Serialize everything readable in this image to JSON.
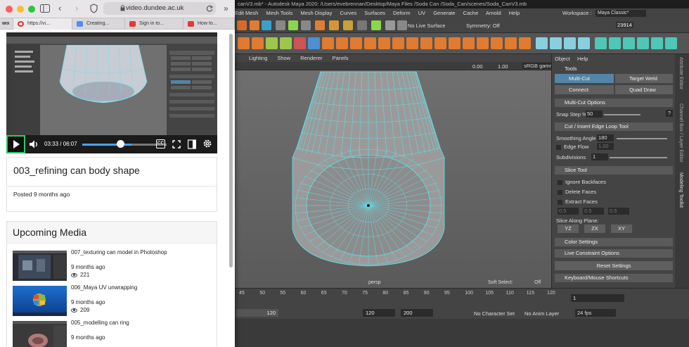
{
  "maya": {
    "title": "canV3.mb* - Autodesk Maya 2020: /Users/evebrennan/Desktop/Maya Files /Soda Can /Soda_Can/scenes/Soda_CanV3.mb",
    "menu": [
      "Edit Mesh",
      "Mesh Tools",
      "Mesh Display",
      "Curves",
      "Surfaces",
      "Deform",
      "UV",
      "Generate",
      "Cache",
      "Arnold",
      "Help"
    ],
    "workspace_label": "Workspace :",
    "workspace_value": "Maya Classic*",
    "status": {
      "no_live_surface": "No Live Surface",
      "symmetry": "Symmetry: Off",
      "poly_count": "23914"
    },
    "viewport": {
      "menu": [
        "Lighting",
        "Show",
        "Renderer",
        "Panels"
      ],
      "value_a": "0.00",
      "value_b": "1.00",
      "colorspace": "sRGB gamm",
      "camera": "persp",
      "soft_select_label": "Soft Select:",
      "soft_select_value": "Off"
    },
    "toolkit": {
      "menu": [
        "Object",
        "Help"
      ],
      "tools_header": "Tools",
      "tools": [
        "Multi-Cut",
        "Target Weld",
        "Connect",
        "Quad Draw"
      ],
      "multicut_header": "Multi-Cut Options",
      "snap_step_label": "Snap Step %",
      "snap_step_value": "50",
      "help_btn": "?",
      "cut_header": "Cut / Insert Edge Loop Tool",
      "smoothing_label": "Smoothing Angle",
      "smoothing_value": "180",
      "edge_flow_label": "Edge Flow",
      "edge_flow_value": "1.00",
      "subdivisions_label": "Subdivisions",
      "subdivisions_value": "1",
      "slice_header": "Slice Tool",
      "slice_options": [
        "Ignore Backfaces",
        "Delete Faces",
        "Extract Faces"
      ],
      "slice_values": [
        "0.5",
        "0.5",
        "0.5"
      ],
      "slice_plane_label": "Slice Along Plane:",
      "axes": [
        "YZ",
        "ZX",
        "XY"
      ],
      "color_settings": "Color Settings",
      "constraint_options": "Live Constraint Options",
      "reset": "Reset Settings",
      "shortcuts": "Keyboard/Mouse Shortcuts"
    },
    "side_tabs": [
      "Attribute Editor",
      "Channel Box / Layer Editor",
      "Modeling Toolkit"
    ],
    "timeline": {
      "ticks": [
        "45",
        "50",
        "55",
        "60",
        "65",
        "70",
        "75",
        "80",
        "85",
        "90",
        "95",
        "100",
        "105",
        "110",
        "115",
        "120"
      ],
      "current_frame": "1",
      "range_start_field": "120",
      "range_end": "120",
      "anim_end": "200",
      "no_character": "No Character Set",
      "no_anim_layer": "No Anim Layer",
      "fps": "24 fps"
    },
    "colors": {
      "wire": "#5fe3f0",
      "mesh": "#9a9a9a",
      "highlight": "#5285a6"
    }
  },
  "safari": {
    "url": "video.dundee.ac.uk",
    "tabs": [
      {
        "label": "",
        "favicon": "wix"
      },
      {
        "label": "https://vi...",
        "favicon": "dundee"
      },
      {
        "label": "Creating...",
        "favicon": "doc"
      },
      {
        "label": "Sign in to...",
        "favicon": "red"
      },
      {
        "label": "How to...",
        "favicon": "red"
      }
    ],
    "wix_badge": "WIX",
    "player": {
      "time": "03:33 / 06:07",
      "progress": 0.58,
      "cc_label": "CC"
    },
    "video_title": "003_refining can body shape",
    "posted": "Posted 9 months ago",
    "upcoming_title": "Upcoming Media",
    "upcoming": [
      {
        "title": "007_texturing can model in Photoshop",
        "ago": "9 months ago",
        "views": "221"
      },
      {
        "title": "006_Maya UV unwrapping",
        "ago": "9 months ago",
        "views": "209"
      },
      {
        "title": "005_modelling can ring",
        "ago": "9 months ago",
        "views": ""
      }
    ]
  }
}
